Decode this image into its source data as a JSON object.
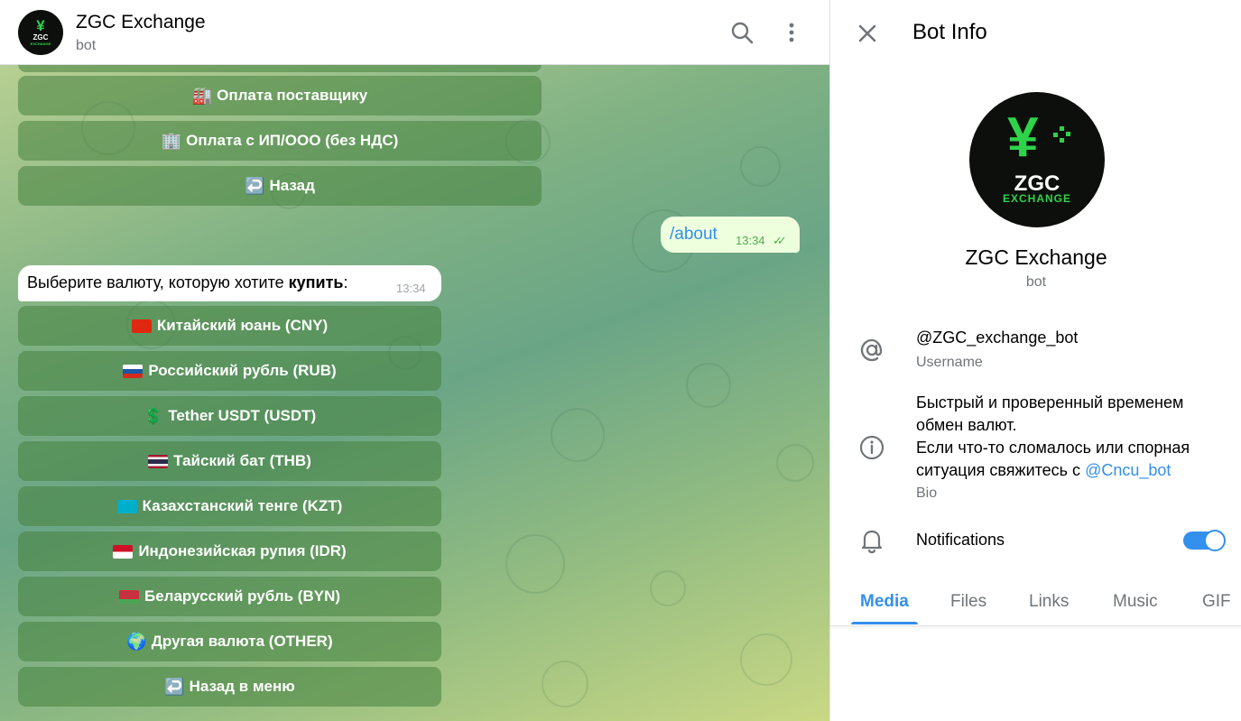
{
  "chat": {
    "title": "ZGC Exchange",
    "subtitle": "bot",
    "avatar_text": {
      "symbol": "¥",
      "name": "ZGC",
      "sub": "EXCHANGE"
    },
    "icons": {
      "search": "search-icon",
      "more": "more-vertical-icon"
    }
  },
  "keyboard_top": [
    {
      "emoji": "🏭",
      "label": "Оплата поставщику"
    },
    {
      "emoji": "🏢",
      "label": "Оплата с ИП/ООО (без НДС)"
    },
    {
      "emoji": "↩️",
      "label": "Назад"
    }
  ],
  "outgoing": {
    "text": "/about",
    "time": "13:34",
    "status_icon": "double-check-icon"
  },
  "incoming": {
    "text_before": "Выберите валюту, которую хотите ",
    "text_bold": "купить",
    "text_after": ":",
    "time": "13:34"
  },
  "currency_buttons": [
    {
      "flag": "cn",
      "label": "Китайский юань (CNY)"
    },
    {
      "flag": "ru",
      "label": "Российский рубль (RUB)"
    },
    {
      "emoji": "💲",
      "label": "Tether USDT (USDT)"
    },
    {
      "flag": "th",
      "label": "Тайский бат (THB)"
    },
    {
      "flag": "kz",
      "label": "Казахстанский тенге (KZT)"
    },
    {
      "flag": "id",
      "label": "Индонезийская рупия (IDR)"
    },
    {
      "flag": "by",
      "label": "Беларусский рубль (BYN)"
    },
    {
      "emoji": "🌍",
      "label": "Другая валюта (OTHER)"
    },
    {
      "emoji": "↩️",
      "label": "Назад в меню"
    }
  ],
  "panel": {
    "title": "Bot Info",
    "name": "ZGC Exchange",
    "subtitle": "bot",
    "avatar_text": {
      "symbol": "¥",
      "name": "ZGC",
      "sub": "EXCHANGE"
    },
    "username": {
      "value": "@ZGC_exchange_bot",
      "label": "Username"
    },
    "bio": {
      "line1": "Быстрый и проверенный временем обмен валют.",
      "line2": "Если что-то сломалось или спорная ситуация свяжитесь с ",
      "link": "@Cncu_bot",
      "label": "Bio"
    },
    "notifications": {
      "label": "Notifications",
      "enabled": true
    },
    "tabs": [
      "Media",
      "Files",
      "Links",
      "Music",
      "GIF"
    ],
    "active_tab": "Media"
  },
  "colors": {
    "accent": "#3390ec",
    "brand_green": "#2fd34a",
    "outgoing_bubble": "#eeffde"
  }
}
